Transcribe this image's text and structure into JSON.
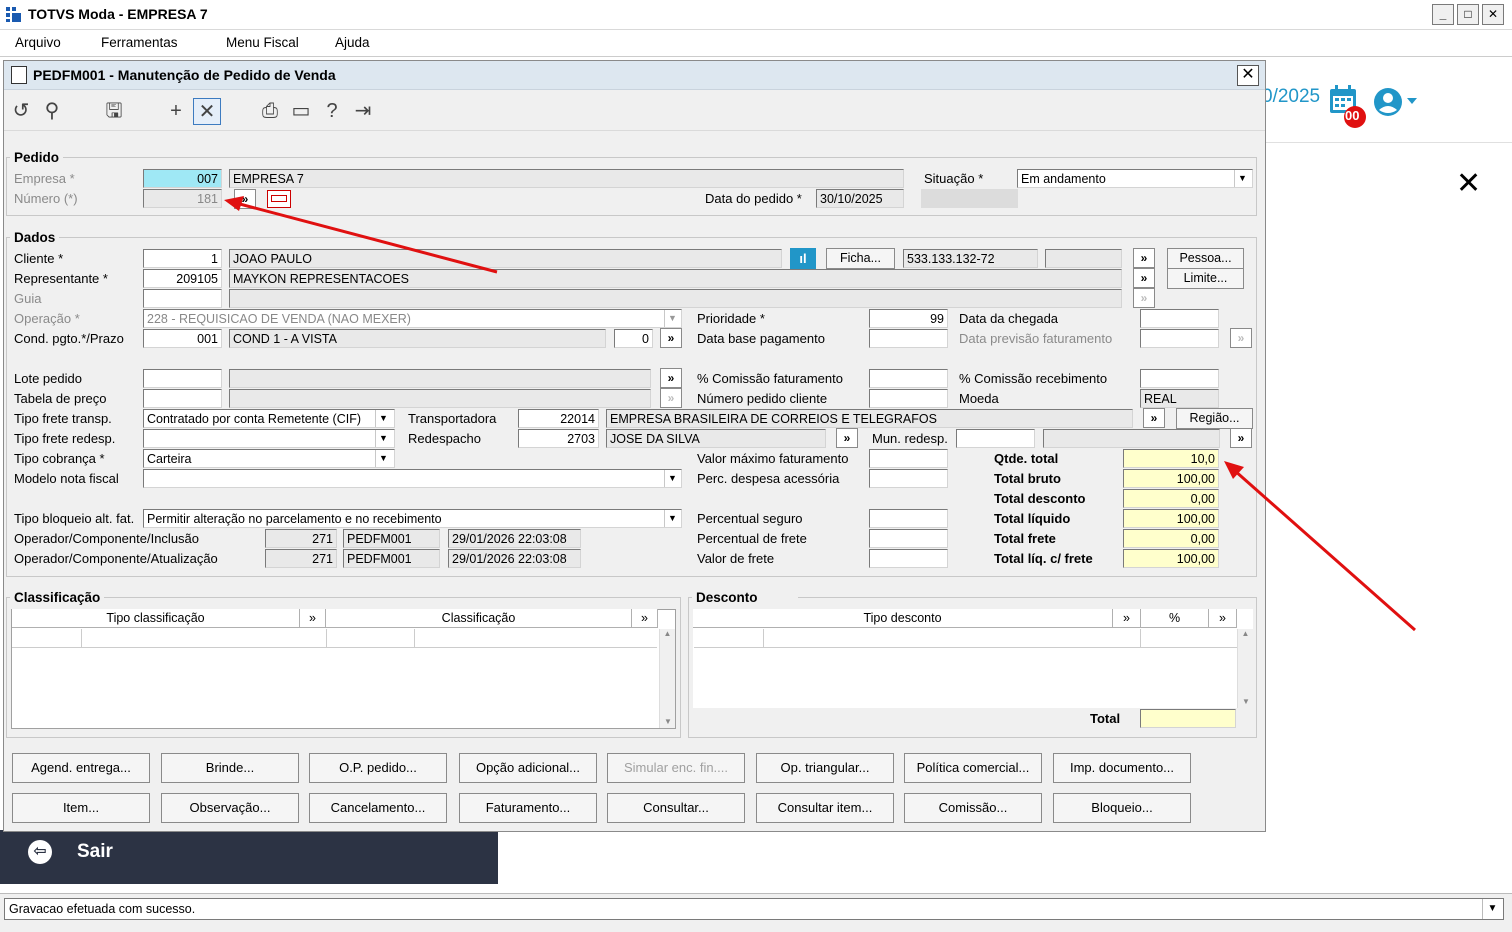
{
  "app": {
    "title": "TOTVS Moda - EMPRESA 7"
  },
  "menu": [
    "Arquivo",
    "Ferramentas",
    "Menu Fiscal",
    "Ajuda"
  ],
  "background": {
    "date_fragment": "0/2025",
    "badge": "00",
    "exit_label": "Sair"
  },
  "dialog": {
    "title": "PEDFM001 - Manutenção de Pedido de Venda"
  },
  "pedido": {
    "group": "Pedido",
    "empresa_label": "Empresa *",
    "empresa_code": "007",
    "empresa_name": "EMPRESA 7",
    "numero_label": "Número (*)",
    "numero": "181",
    "data_label": "Data do pedido *",
    "data": "30/10/2025",
    "situacao_label": "Situação *",
    "situacao": "Em andamento"
  },
  "dados": {
    "group": "Dados",
    "cliente_label": "Cliente *",
    "cliente_code": "1",
    "cliente_name": "JOAO PAULO",
    "ficha_btn": "Ficha...",
    "cpf": "533.133.132-72",
    "pessoa_btn": "Pessoa...",
    "limite_btn": "Limite...",
    "repr_label": "Representante *",
    "repr_code": "209105",
    "repr_name": "MAYKON REPRESENTACOES",
    "guia_label": "Guia",
    "operacao_label": "Operação *",
    "operacao": "228 - REQUISICAO DE VENDA (NAO MEXER)",
    "cond_label": "Cond. pgto.*/Prazo",
    "cond_code": "001",
    "cond_name": "COND 1 - A VISTA",
    "prazo": "0",
    "prioridade_label": "Prioridade *",
    "prioridade": "99",
    "data_base_label": "Data base pagamento",
    "data_chegada_label": "Data da chegada",
    "data_prev_label": "Data previsão faturamento",
    "lote_label": "Lote pedido",
    "tabela_label": "Tabela de preço",
    "comissao_fat_label": "% Comissão faturamento",
    "num_ped_cli_label": "Número pedido cliente",
    "comissao_rec_label": "% Comissão recebimento",
    "moeda_label": "Moeda",
    "moeda": "REAL",
    "frete_label": "Tipo frete transp.",
    "frete": "Contratado por conta Remetente (CIF)",
    "transp_label": "Transportadora",
    "transp_code": "22014",
    "transp_name": "EMPRESA BRASILEIRA DE CORREIOS E TELEGRAFOS",
    "regiao_btn": "Região...",
    "frete_redesp_label": "Tipo frete redesp.",
    "redesp_label": "Redespacho",
    "redesp_code": "2703",
    "redesp_name": "JOSE DA SILVA",
    "mun_redesp_label": "Mun. redesp.",
    "cobranca_label": "Tipo cobrança *",
    "cobranca": "Carteira",
    "modelo_label": "Modelo nota fiscal",
    "valor_max_label": "Valor máximo faturamento",
    "perc_desp_label": "Perc. despesa acessória",
    "bloqueio_label": "Tipo bloqueio alt. fat.",
    "bloqueio": "Permitir alteração no parcelamento e no recebimento",
    "op_incl_label": "Operador/Componente/Inclusão",
    "op_incl_code": "271",
    "op_incl_comp": "PEDFM001",
    "op_incl_date": "29/01/2026 22:03:08",
    "op_atual_label": "Operador/Componente/Atualização",
    "op_atual_code": "271",
    "op_atual_comp": "PEDFM001",
    "op_atual_date": "29/01/2026 22:03:08",
    "perc_seguro_label": "Percentual seguro",
    "perc_frete_label": "Percentual de frete",
    "valor_frete_label": "Valor de frete"
  },
  "totals": {
    "qtde_label": "Qtde. total",
    "qtde": "10,0",
    "bruto_label": "Total bruto",
    "bruto": "100,00",
    "desconto_label": "Total desconto",
    "desconto": "0,00",
    "liquido_label": "Total líquido",
    "liquido": "100,00",
    "frete_label": "Total frete",
    "frete": "0,00",
    "liq_frete_label": "Total líq. c/ frete",
    "liq_frete": "100,00"
  },
  "classificacao": {
    "group": "Classificação",
    "col1": "Tipo classificação",
    "col2": "Classificação"
  },
  "desconto": {
    "group": "Desconto",
    "col1": "Tipo desconto",
    "col2": "%",
    "total_label": "Total"
  },
  "buttons_row1": [
    "Agend. entrega...",
    "Brinde...",
    "O.P. pedido...",
    "Opção adicional...",
    "Simular enc. fin....",
    "Op. triangular...",
    "Política comercial...",
    "Imp. documento..."
  ],
  "buttons_row2": [
    "Item...",
    "Observação...",
    "Cancelamento...",
    "Faturamento...",
    "Consultar...",
    "Consultar item...",
    "Comissão...",
    "Bloqueio..."
  ],
  "status": "Gravacao efetuada com sucesso.",
  "colors": {
    "accent": "#2196c8",
    "annotation": "#e01010",
    "highlight_cyan": "#9fe8f5",
    "highlight_yellow": "#ffffcc",
    "sidebar": "#2c3344"
  }
}
